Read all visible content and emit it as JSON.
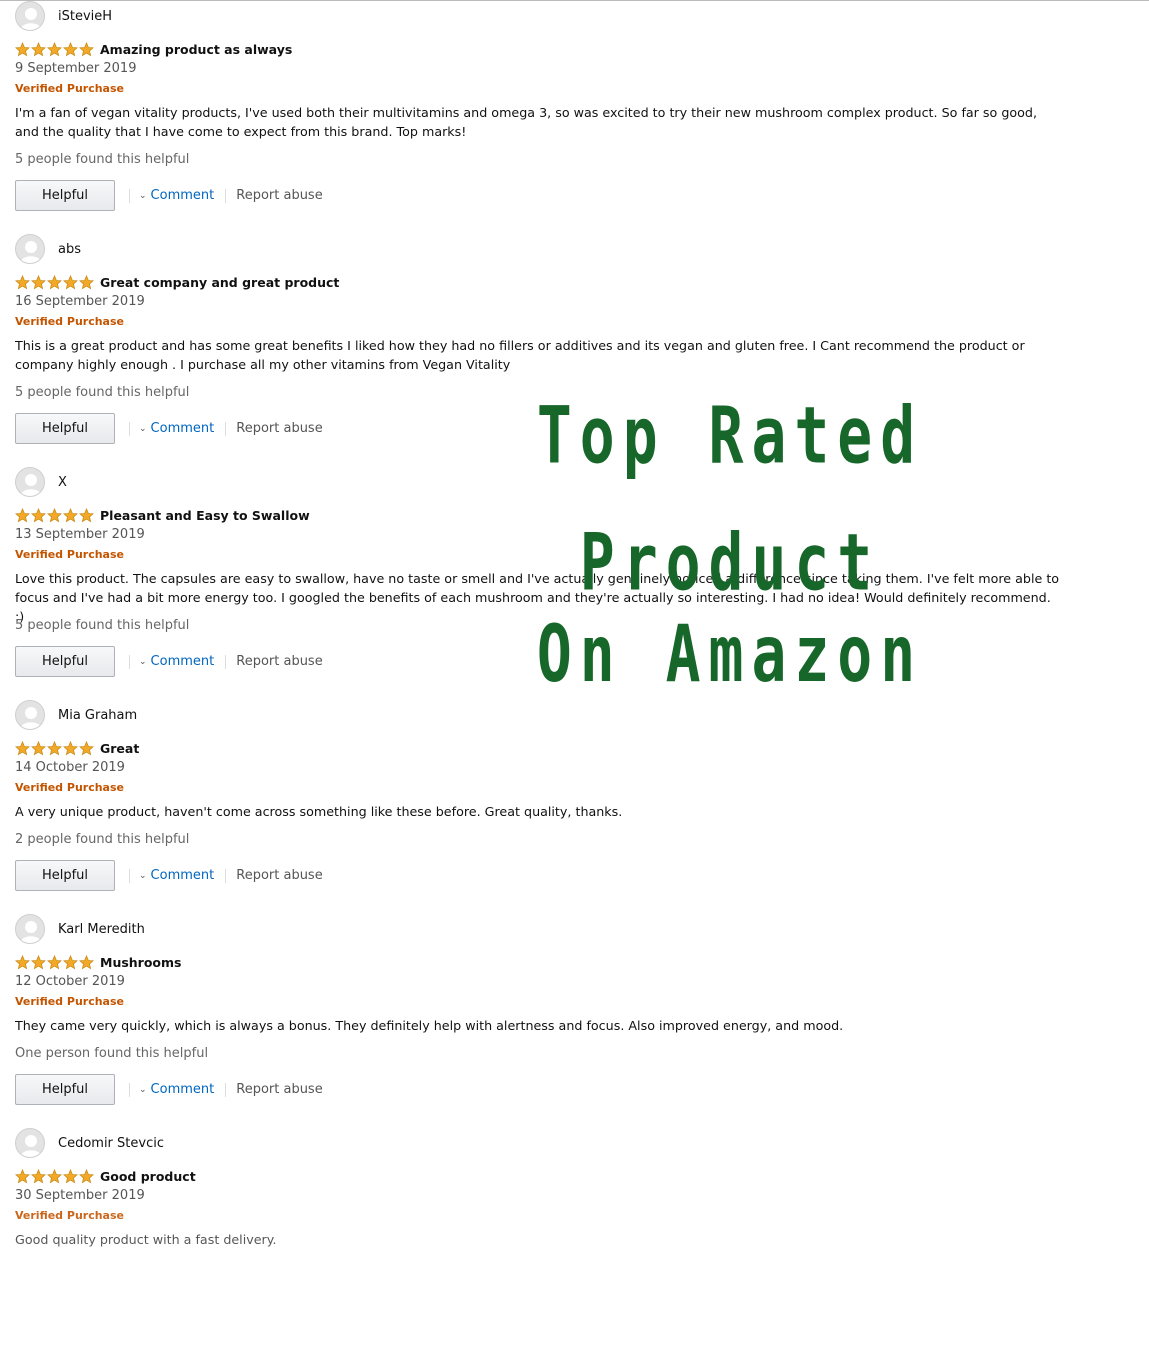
{
  "labels": {
    "verified": "Verified Purchase",
    "helpful_button": "Helpful",
    "comment": "Comment",
    "report_abuse": "Report abuse"
  },
  "colors": {
    "star": "#f1a927",
    "verified": "#c45500",
    "link": "#0066c0",
    "overlay": "#17672a"
  },
  "overlay": {
    "line1": "Top Rated Product",
    "line2": "On Amazon"
  },
  "reviews": [
    {
      "name": "iStevieH",
      "rating": 5,
      "title": "Amazing product as always",
      "date": "9 September 2019",
      "body": "I'm a fan of vegan vitality products, I've used both their multivitamins and omega 3, so was excited to try their new mushroom complex product. So far so good, and the quality that I have come to expect from this brand. Top marks!",
      "helpful_count": "5 people found this helpful"
    },
    {
      "name": "abs",
      "rating": 5,
      "title": "Great company and great product",
      "date": "16 September 2019",
      "body": "This is a great product and has some great benefits I liked how they had no fillers or additives and its vegan and gluten free. I Cant recommend the product or company highly enough . I purchase all my other vitamins from Vegan Vitality",
      "helpful_count": "5 people found this helpful"
    },
    {
      "name": "X",
      "rating": 5,
      "title": "Pleasant and Easy to Swallow",
      "date": "13 September 2019",
      "body": "Love this product. The capsules are easy to swallow, have no taste or smell and I've actually genuinely noticed a difference since taking them. I've felt more able to focus and I've had a bit more energy too. I googled the benefits of each mushroom and they're actually so interesting. I had no idea! Would definitely recommend. :)",
      "helpful_count": "5 people found this helpful"
    },
    {
      "name": "Mia Graham",
      "rating": 5,
      "title": "Great",
      "date": "14 October 2019",
      "body": "A very unique product, haven't come across something like these before. Great quality, thanks.",
      "helpful_count": "2 people found this helpful"
    },
    {
      "name": "Karl Meredith",
      "rating": 5,
      "title": "Mushrooms",
      "date": "12 October 2019",
      "body": "They came very quickly, which is always a bonus. They definitely help with alertness and focus. Also improved energy, and mood.",
      "helpful_count": "One person found this helpful"
    },
    {
      "name": "Cedomir Stevcic",
      "rating": 5,
      "title": "Good product",
      "date": "30 September 2019",
      "body": "Good quality product with a fast delivery.",
      "helpful_count": ""
    }
  ]
}
